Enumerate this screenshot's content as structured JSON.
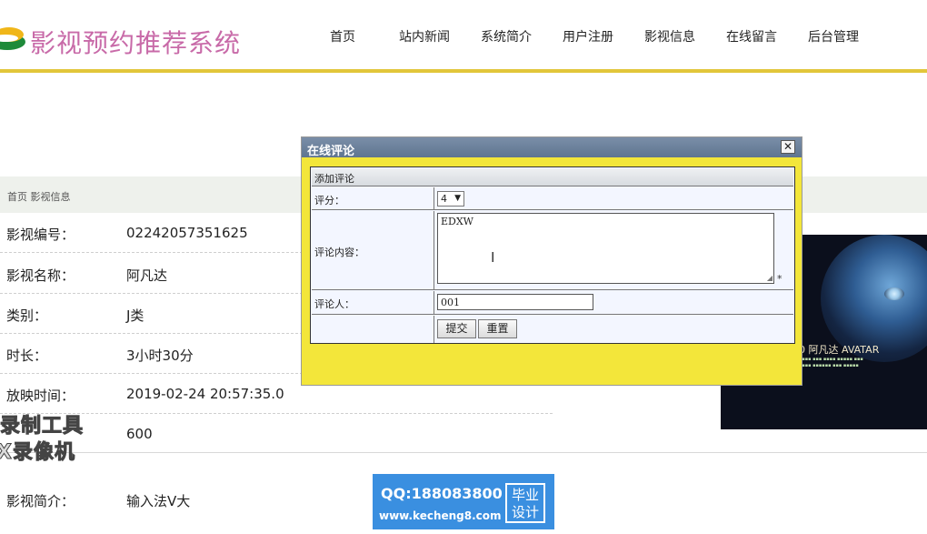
{
  "header": {
    "logo_text": "影视预约推荐系统",
    "nav": [
      "首页",
      "站内新闻",
      "系统简介",
      "用户注册",
      "影视信息",
      "在线留言",
      "后台管理"
    ],
    "accent_color": "#e2c63a"
  },
  "breadcrumb": "首页 影视信息",
  "details": [
    {
      "label": "影视编号：",
      "value": "02242057351625"
    },
    {
      "label": "影视名称：",
      "value": "阿凡达"
    },
    {
      "label": "类别：",
      "value": "J类"
    },
    {
      "label": "时长：",
      "value": "3小时30分"
    },
    {
      "label": "放映时间：",
      "value": "2019-02-24 20:57:35.0"
    },
    {
      "label": "",
      "value": "600"
    },
    {
      "label": "影视简介：",
      "value": "输入法V大"
    }
  ],
  "poster": {
    "title": "0 阿凡达 AVATAR",
    "icon": "movie-poster-image"
  },
  "dialog": {
    "title": "在线评论",
    "close_label": "✕",
    "section_title": "添加评论",
    "rating": {
      "label": "评分：",
      "selected": "4"
    },
    "content": {
      "label": "评论内容：",
      "value": "EDXW",
      "required_mark": "*"
    },
    "reviewer": {
      "label": "评论人：",
      "value": "001"
    },
    "buttons": {
      "submit": "提交",
      "reset": "重置"
    }
  },
  "watermark": {
    "line1": "录制工具",
    "line2": "X录像机",
    "qq": "QQ:188083800",
    "url": "www.kecheng8.com",
    "badge": "毕业设计"
  }
}
